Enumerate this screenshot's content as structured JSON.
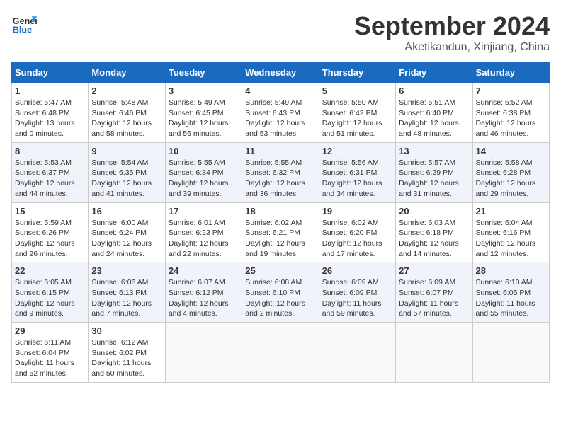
{
  "header": {
    "logo_line1": "General",
    "logo_line2": "Blue",
    "month_title": "September 2024",
    "subtitle": "Aketikandun, Xinjiang, China"
  },
  "calendar": {
    "weekdays": [
      "Sunday",
      "Monday",
      "Tuesday",
      "Wednesday",
      "Thursday",
      "Friday",
      "Saturday"
    ],
    "weeks": [
      [
        null,
        null,
        null,
        null,
        null,
        null,
        null
      ]
    ]
  },
  "days": [
    {
      "num": "1",
      "col": 0,
      "week": 0,
      "sunrise": "5:47 AM",
      "sunset": "6:48 PM",
      "daylight": "13 hours and 0 minutes"
    },
    {
      "num": "2",
      "col": 1,
      "week": 0,
      "sunrise": "5:48 AM",
      "sunset": "6:46 PM",
      "daylight": "12 hours and 58 minutes"
    },
    {
      "num": "3",
      "col": 2,
      "week": 0,
      "sunrise": "5:49 AM",
      "sunset": "6:45 PM",
      "daylight": "12 hours and 56 minutes"
    },
    {
      "num": "4",
      "col": 3,
      "week": 0,
      "sunrise": "5:49 AM",
      "sunset": "6:43 PM",
      "daylight": "12 hours and 53 minutes"
    },
    {
      "num": "5",
      "col": 4,
      "week": 0,
      "sunrise": "5:50 AM",
      "sunset": "6:42 PM",
      "daylight": "12 hours and 51 minutes"
    },
    {
      "num": "6",
      "col": 5,
      "week": 0,
      "sunrise": "5:51 AM",
      "sunset": "6:40 PM",
      "daylight": "12 hours and 48 minutes"
    },
    {
      "num": "7",
      "col": 6,
      "week": 0,
      "sunrise": "5:52 AM",
      "sunset": "6:38 PM",
      "daylight": "12 hours and 46 minutes"
    },
    {
      "num": "8",
      "col": 0,
      "week": 1,
      "sunrise": "5:53 AM",
      "sunset": "6:37 PM",
      "daylight": "12 hours and 44 minutes"
    },
    {
      "num": "9",
      "col": 1,
      "week": 1,
      "sunrise": "5:54 AM",
      "sunset": "6:35 PM",
      "daylight": "12 hours and 41 minutes"
    },
    {
      "num": "10",
      "col": 2,
      "week": 1,
      "sunrise": "5:55 AM",
      "sunset": "6:34 PM",
      "daylight": "12 hours and 39 minutes"
    },
    {
      "num": "11",
      "col": 3,
      "week": 1,
      "sunrise": "5:55 AM",
      "sunset": "6:32 PM",
      "daylight": "12 hours and 36 minutes"
    },
    {
      "num": "12",
      "col": 4,
      "week": 1,
      "sunrise": "5:56 AM",
      "sunset": "6:31 PM",
      "daylight": "12 hours and 34 minutes"
    },
    {
      "num": "13",
      "col": 5,
      "week": 1,
      "sunrise": "5:57 AM",
      "sunset": "6:29 PM",
      "daylight": "12 hours and 31 minutes"
    },
    {
      "num": "14",
      "col": 6,
      "week": 1,
      "sunrise": "5:58 AM",
      "sunset": "6:28 PM",
      "daylight": "12 hours and 29 minutes"
    },
    {
      "num": "15",
      "col": 0,
      "week": 2,
      "sunrise": "5:59 AM",
      "sunset": "6:26 PM",
      "daylight": "12 hours and 26 minutes"
    },
    {
      "num": "16",
      "col": 1,
      "week": 2,
      "sunrise": "6:00 AM",
      "sunset": "6:24 PM",
      "daylight": "12 hours and 24 minutes"
    },
    {
      "num": "17",
      "col": 2,
      "week": 2,
      "sunrise": "6:01 AM",
      "sunset": "6:23 PM",
      "daylight": "12 hours and 22 minutes"
    },
    {
      "num": "18",
      "col": 3,
      "week": 2,
      "sunrise": "6:02 AM",
      "sunset": "6:21 PM",
      "daylight": "12 hours and 19 minutes"
    },
    {
      "num": "19",
      "col": 4,
      "week": 2,
      "sunrise": "6:02 AM",
      "sunset": "6:20 PM",
      "daylight": "12 hours and 17 minutes"
    },
    {
      "num": "20",
      "col": 5,
      "week": 2,
      "sunrise": "6:03 AM",
      "sunset": "6:18 PM",
      "daylight": "12 hours and 14 minutes"
    },
    {
      "num": "21",
      "col": 6,
      "week": 2,
      "sunrise": "6:04 AM",
      "sunset": "6:16 PM",
      "daylight": "12 hours and 12 minutes"
    },
    {
      "num": "22",
      "col": 0,
      "week": 3,
      "sunrise": "6:05 AM",
      "sunset": "6:15 PM",
      "daylight": "12 hours and 9 minutes"
    },
    {
      "num": "23",
      "col": 1,
      "week": 3,
      "sunrise": "6:06 AM",
      "sunset": "6:13 PM",
      "daylight": "12 hours and 7 minutes"
    },
    {
      "num": "24",
      "col": 2,
      "week": 3,
      "sunrise": "6:07 AM",
      "sunset": "6:12 PM",
      "daylight": "12 hours and 4 minutes"
    },
    {
      "num": "25",
      "col": 3,
      "week": 3,
      "sunrise": "6:08 AM",
      "sunset": "6:10 PM",
      "daylight": "12 hours and 2 minutes"
    },
    {
      "num": "26",
      "col": 4,
      "week": 3,
      "sunrise": "6:09 AM",
      "sunset": "6:09 PM",
      "daylight": "11 hours and 59 minutes"
    },
    {
      "num": "27",
      "col": 5,
      "week": 3,
      "sunrise": "6:09 AM",
      "sunset": "6:07 PM",
      "daylight": "11 hours and 57 minutes"
    },
    {
      "num": "28",
      "col": 6,
      "week": 3,
      "sunrise": "6:10 AM",
      "sunset": "6:05 PM",
      "daylight": "11 hours and 55 minutes"
    },
    {
      "num": "29",
      "col": 0,
      "week": 4,
      "sunrise": "6:11 AM",
      "sunset": "6:04 PM",
      "daylight": "11 hours and 52 minutes"
    },
    {
      "num": "30",
      "col": 1,
      "week": 4,
      "sunrise": "6:12 AM",
      "sunset": "6:02 PM",
      "daylight": "11 hours and 50 minutes"
    }
  ]
}
